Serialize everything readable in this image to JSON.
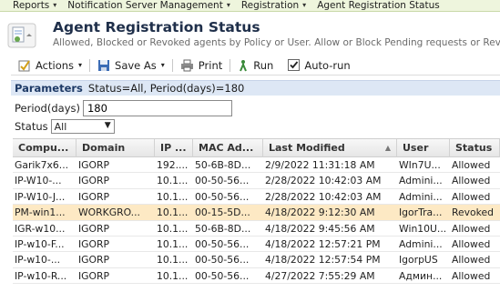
{
  "menu": {
    "items": [
      {
        "label": "Reports",
        "dropdown": true
      },
      {
        "label": "Notification Server Management",
        "dropdown": true
      },
      {
        "label": "Registration",
        "dropdown": true
      },
      {
        "label": "Agent Registration Status",
        "dropdown": false
      }
    ]
  },
  "header": {
    "title": "Agent Registration Status",
    "subtitle": "Allowed, Blocked or Revoked agents by Policy or User. Allow or Block Pending requests or Revoke"
  },
  "toolbar": {
    "actions_label": "Actions",
    "save_as_label": "Save As",
    "print_label": "Print",
    "run_label": "Run",
    "autorun_label": "Auto-run",
    "autorun_checked": true
  },
  "parameters": {
    "heading": "Parameters",
    "summary": "Status=All, Period(days)=180",
    "period_label": "Period(days)",
    "period_value": "180",
    "status_label": "Status",
    "status_value": "All"
  },
  "table": {
    "columns": [
      "Compu...",
      "Domain",
      "IP ...",
      "MAC Ad...",
      "Last Modified",
      "User",
      "Status"
    ],
    "rows": [
      [
        "Garik7x6...",
        "IGORP",
        "192....",
        "50-6B-8D...",
        "2/9/2022 11:31:18 AM",
        "WIn7U...",
        "Allowed"
      ],
      [
        "IP-W10-...",
        "IGORP",
        "10.1...",
        "00-50-56...",
        "2/28/2022 10:42:03 AM",
        "Admini...",
        "Allowed"
      ],
      [
        "IP-W10-J...",
        "IGORP",
        "10.1...",
        "00-50-56...",
        "2/28/2022 10:42:03 AM",
        "Admini...",
        "Allowed"
      ],
      [
        "PM-win1...",
        "WORKGRO...",
        "10.1...",
        "00-15-5D...",
        "4/18/2022 9:12:30 AM",
        "IgorTra...",
        "Revoked"
      ],
      [
        "IGR-w10...",
        "IGORP",
        "10.1...",
        "50-6B-8D...",
        "4/18/2022 9:45:56 AM",
        "Win10U...",
        "Allowed"
      ],
      [
        "IP-w10-F...",
        "IGORP",
        "10.1...",
        "00-50-56...",
        "4/18/2022 12:57:21 PM",
        "Admini...",
        "Allowed"
      ],
      [
        "IP-w10-...",
        "IGORP",
        "10.1...",
        "00-50-56...",
        "4/18/2022 12:57:54 PM",
        "IgorpUS",
        "Allowed"
      ],
      [
        "IP-w10-R...",
        "IGORP",
        "10.1...",
        "00-50-56...",
        "4/27/2022 7:55:29 AM",
        "Админ...",
        "Allowed"
      ]
    ],
    "highlighted_row": 3,
    "highlight_color": "#fde9c4"
  },
  "colors": {
    "menu_bg": "#eef5dd",
    "params_bg": "#dde7f5",
    "title": "#1f2f4a"
  }
}
